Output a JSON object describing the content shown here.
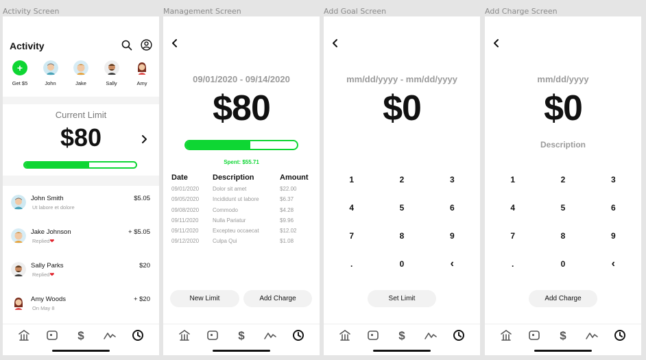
{
  "frames": [
    "Activity Screen",
    "Management Screen",
    "Add Goal Screen",
    "Add Charge Screen"
  ],
  "activity": {
    "title": "Activity",
    "contacts": [
      {
        "name": "Get $5"
      },
      {
        "name": "John"
      },
      {
        "name": "Jake"
      },
      {
        "name": "Sally"
      },
      {
        "name": "Amy"
      }
    ],
    "limit_label": "Current Limit",
    "limit_amount": "$80",
    "limit_progress": 0.58,
    "transactions": [
      {
        "name": "John Smith",
        "sub": "Ut labore et dolore",
        "amount": "$5.05",
        "heart": false
      },
      {
        "name": "Jake Johnson",
        "sub": "Replied",
        "amount": "+ $5.05",
        "heart": true
      },
      {
        "name": "Sally Parks",
        "sub": "Replied",
        "amount": "$20",
        "heart": true
      },
      {
        "name": "Amy Woods",
        "sub": "On May 8",
        "amount": "+ $20",
        "heart": false
      }
    ]
  },
  "management": {
    "date_range": "09/01/2020 - 09/14/2020",
    "amount": "$80",
    "progress": 0.58,
    "spent": "Spent: $55.71",
    "columns": [
      "Date",
      "Description",
      "Amount"
    ],
    "rows": [
      [
        "09/01/2020",
        "Dolor sit amet",
        "$22.00"
      ],
      [
        "09/05/2020",
        "Incididunt ut labore",
        "$6.37"
      ],
      [
        "09/08/2020",
        "Commodo",
        "$4.28"
      ],
      [
        "09/11/2020",
        "Nulla Pariatur",
        "$9.96"
      ],
      [
        "09/11/2020",
        "Excepteu occaecat",
        "$12.02"
      ],
      [
        "09/12/2020",
        "Culpa Qui",
        "$1.08"
      ]
    ],
    "new_limit_label": "New Limit",
    "add_charge_label": "Add Charge"
  },
  "add_goal": {
    "date_placeholder": "mm/dd/yyyy - mm/dd/yyyy",
    "amount": "$0",
    "keys": [
      "1",
      "2",
      "3",
      "4",
      "5",
      "6",
      "7",
      "8",
      "9",
      ".",
      "0",
      "‹"
    ],
    "button_label": "Set Limit"
  },
  "add_charge": {
    "date_placeholder": "mm/dd/yyyy",
    "amount": "$0",
    "description_placeholder": "Description",
    "keys": [
      "1",
      "2",
      "3",
      "4",
      "5",
      "6",
      "7",
      "8",
      "9",
      ".",
      "0",
      "‹"
    ],
    "button_label": "Add Charge"
  },
  "tabbar": {
    "icons": [
      "home-icon",
      "wallet-icon",
      "dollar-icon",
      "chart-icon",
      "clock-icon"
    ],
    "active": "clock-icon"
  },
  "colors": {
    "accent": "#0ed633",
    "heart": "#e0202a"
  }
}
